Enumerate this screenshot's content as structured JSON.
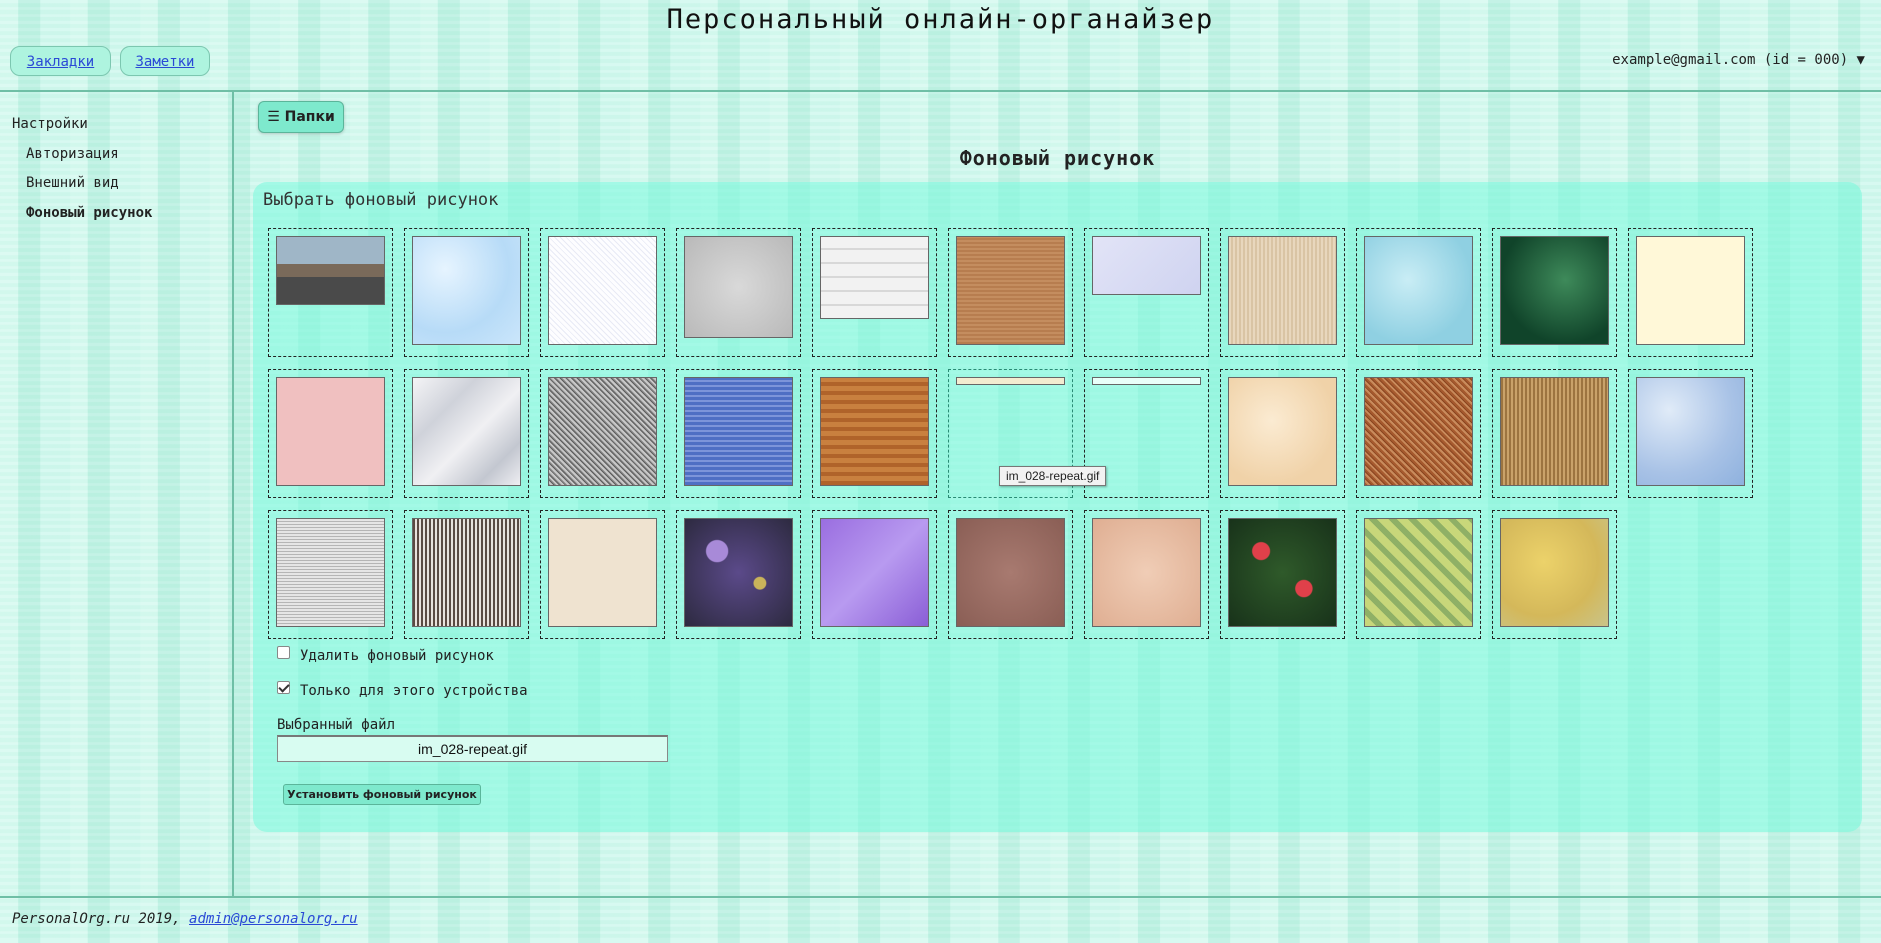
{
  "header": {
    "title": "Персональный онлайн-органайзер",
    "nav": {
      "bookmarks": "Закладки",
      "notes": "Заметки"
    },
    "user": "example@gmail.com (id = 000) ▼"
  },
  "sidebar": {
    "section": "Настройки",
    "items": [
      "Авторизация",
      "Внешний вид",
      "Фоновый рисунок"
    ]
  },
  "main": {
    "folders_button": "☰ Папки",
    "page_title": "Фоновый рисунок",
    "panel_heading": "Выбрать фоновый рисунок",
    "delete_label": "Удалить фоновый рисунок",
    "delete_checked": false,
    "device_label": "Только для этого устройства",
    "device_checked": true,
    "file_label": "Выбранный файл",
    "file_value": "im_028-repeat.gif",
    "set_button": "Установить фоновый рисунок",
    "tooltip": "im_028-repeat.gif"
  },
  "footer": {
    "text": "PersonalOrg.ru 2019, ",
    "email": "admin@personalorg.ru"
  },
  "colors": {
    "accent": "#7ee9cd",
    "link": "#2a49d6",
    "border": "#6fbfa6"
  }
}
